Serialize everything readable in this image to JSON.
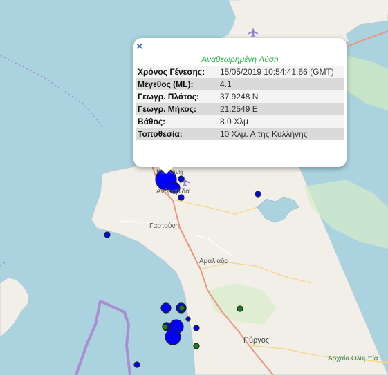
{
  "popup": {
    "title": "Αναθεωρημένη Λύση",
    "close_icon": "×",
    "rows": [
      {
        "key": "Χρόνος Γένεσης:",
        "value": "15/05/2019 10:54:41.66 (GMT)"
      },
      {
        "key": "Μέγεθος (ML):",
        "value": "4.1"
      },
      {
        "key": "Γεωγρ. Πλάτος:",
        "value": "37.9248 N"
      },
      {
        "key": "Γεωγρ. Μήκος:",
        "value": "21.2549 E"
      },
      {
        "key": "Βάθος:",
        "value": "8.0 Χλμ"
      },
      {
        "key": "Τοποθεσία:",
        "value": "10 Χλμ. Α της Κυλλήνης"
      }
    ]
  },
  "places": {
    "kyllini": "Κυλλήνη",
    "andravida": "Ανδραβίδα",
    "gastouni": "Γαστούνη",
    "amaliada": "Αμαλιάδα",
    "pyrgos": "Πύργος",
    "olympia": "Αρχαία Ολυμπία"
  },
  "colors": {
    "sea": "#aad3df",
    "land": "#f2efe9",
    "quake_recent": "#0000ff",
    "quake_older": "#1a7f1a",
    "popup_title": "#2fb24a"
  },
  "icons": {
    "airport": "airplane-icon",
    "close": "close-icon"
  }
}
